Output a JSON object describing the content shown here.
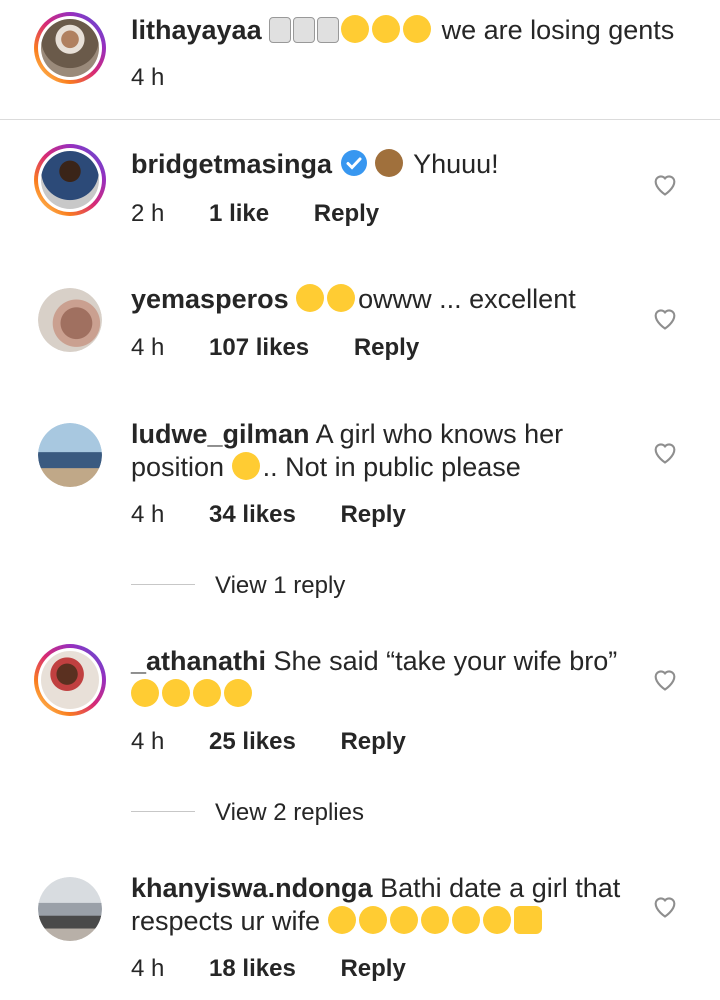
{
  "comments": [
    {
      "username": "lithayayaa",
      "text": "we are losing gents",
      "time": "4 h",
      "likes": "",
      "reply": ""
    },
    {
      "username": "bridgetmasinga",
      "text": "Yhuuu!",
      "time": "2 h",
      "likes": "1 like",
      "reply": "Reply"
    },
    {
      "username": "yemasperos",
      "text": "owww ... excellent",
      "time": "4 h",
      "likes": "107 likes",
      "reply": "Reply"
    },
    {
      "username": "ludwe_gilman",
      "text_line1": "A girl who knows her",
      "text_line2a": "position",
      "text_line2b": ".. Not in public please",
      "time": "4 h",
      "likes": "34 likes",
      "reply": "Reply"
    },
    {
      "username": "_athanathi",
      "text": "She said “take your wife bro”",
      "time": "4 h",
      "likes": "25 likes",
      "reply": "Reply"
    },
    {
      "username": "khanyiswa.ndonga",
      "text_line1": "Bathi date a girl that",
      "text_line2": "respects ur wife",
      "time": "4 h",
      "likes": "18 likes",
      "reply": "Reply"
    }
  ],
  "view_replies": [
    "View 1 reply",
    "View 2 replies"
  ],
  "icons": {
    "like": "heart-outline-icon",
    "verified": "verified-badge-icon"
  },
  "colors": {
    "verified": "#3897f0",
    "divider": "#dbdbdb"
  }
}
